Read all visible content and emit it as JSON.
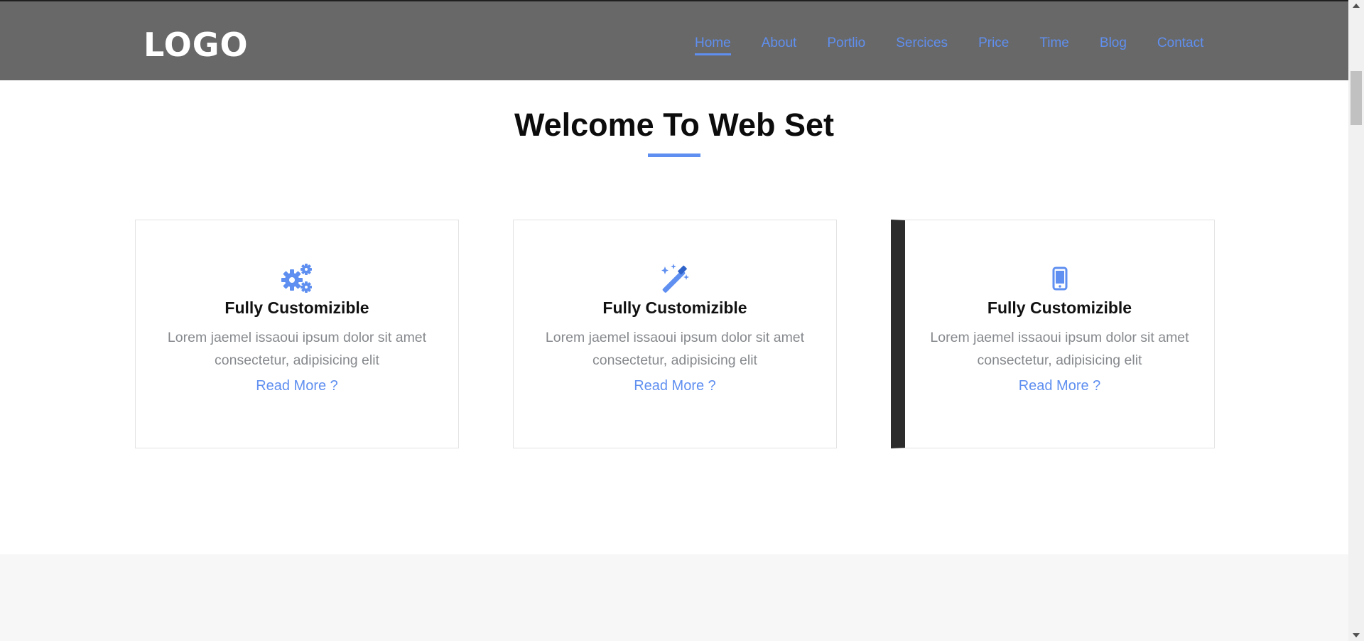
{
  "header": {
    "logo": "LOGO",
    "nav": [
      "Home",
      "About",
      "Portlio",
      "Sercices",
      "Price",
      "Time",
      "Blog",
      "Contact"
    ],
    "active_nav": "Home"
  },
  "section": {
    "title": "Welcome To Web Set"
  },
  "cards": [
    {
      "icon": "gears-icon",
      "title": "Fully Customizible",
      "line1": "Lorem jaemel issaoui ipsum dolor sit amet",
      "line2": "consectetur, adipisicing elit",
      "link": "Read More ?"
    },
    {
      "icon": "magic-wand-icon",
      "title": "Fully Customizible",
      "line1": "Lorem jaemel issaoui ipsum dolor sit amet",
      "line2": "consectetur, adipisicing elit",
      "link": "Read More ?"
    },
    {
      "icon": "mobile-phone-icon",
      "title": "Fully Customizible",
      "line1": "Lorem jaemel issaoui ipsum dolor sit amet",
      "line2": "consectetur, adipisicing elit",
      "link": "Read More ?"
    }
  ],
  "colors": {
    "accent": "#5f8ff0",
    "header_bg": "#686868",
    "card_highlight": "#2c2c2c"
  }
}
